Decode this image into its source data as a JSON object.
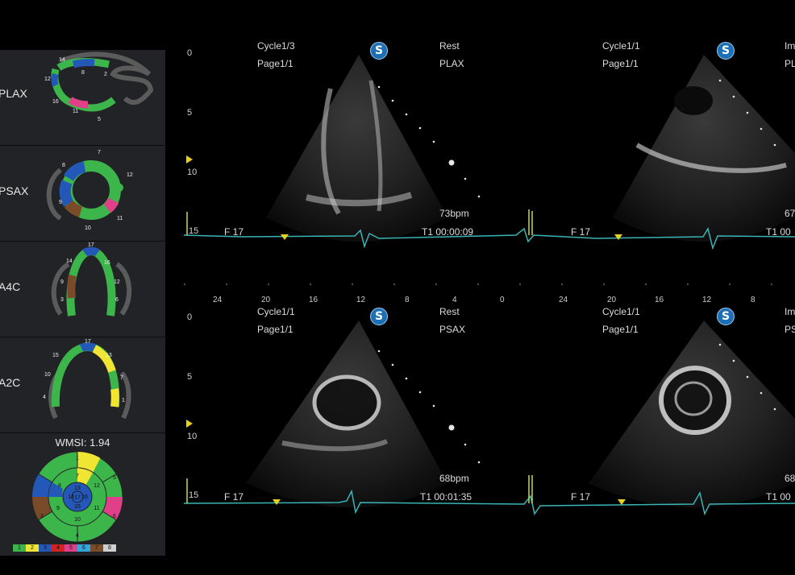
{
  "sidebar": {
    "views": [
      {
        "label": "PLAX",
        "segments": [
          "14",
          "12",
          "16",
          "11",
          "5",
          "8",
          "2"
        ]
      },
      {
        "label": "PSAX",
        "segments": [
          "8",
          "7",
          "12",
          "9",
          "10",
          "11"
        ]
      },
      {
        "label": "A4C",
        "segments": [
          "17",
          "14",
          "16",
          "9",
          "12",
          "6",
          "3"
        ]
      },
      {
        "label": "A2C",
        "segments": [
          "17",
          "15",
          "13",
          "10",
          "7",
          "4",
          "1"
        ]
      }
    ],
    "wmsi_label": "WMSI:  1.94",
    "bullseye_numbers": [
      "1",
      "7",
      "13",
      "14",
      "16",
      "17",
      "8",
      "15",
      "4",
      "10",
      "3",
      "9",
      "12",
      "11",
      "6",
      "5"
    ],
    "legend": [
      {
        "n": "1",
        "color": "#3cb64a"
      },
      {
        "n": "2",
        "color": "#f0e533"
      },
      {
        "n": "3",
        "color": "#2357b8"
      },
      {
        "n": "4",
        "color": "#d22222"
      },
      {
        "n": "5",
        "color": "#e0408a"
      },
      {
        "n": "6",
        "color": "#35a6dc"
      },
      {
        "n": "7",
        "color": "#7a4b28"
      },
      {
        "n": "8",
        "color": "#cfcfcf"
      }
    ]
  },
  "panes": [
    {
      "cycle": "Cycle1/3",
      "page": "Page1/1",
      "stage": "Rest",
      "view": "PLAX",
      "bpm": "73bpm",
      "time": "T1 00:00:09",
      "fps": "F 17"
    },
    {
      "cycle": "Cycle1/1",
      "page": "Page1/1",
      "stage": "Im",
      "view": "PL",
      "bpm": "67",
      "time": "T1 00",
      "fps": "F 17"
    },
    {
      "cycle": "Cycle1/1",
      "page": "Page1/1",
      "stage": "Rest",
      "view": "PSAX",
      "bpm": "68bpm",
      "time": "T1 00:01:35",
      "fps": "F 17"
    },
    {
      "cycle": "Cycle1/1",
      "page": "Page1/1",
      "stage": "Im",
      "view": "PS",
      "bpm": "68",
      "time": "T1 00",
      "fps": "F 17"
    }
  ],
  "depth_scale": [
    "0",
    "5",
    "10",
    "15"
  ],
  "time_axis": [
    "24",
    "20",
    "16",
    "12",
    "8",
    "4",
    "0",
    "24",
    "20",
    "16",
    "12",
    "8"
  ],
  "s_button_label": "S",
  "colors": {
    "ecg": "#3ab5b5",
    "marker": "#e8d21f",
    "accent": "#1d6fb5"
  }
}
